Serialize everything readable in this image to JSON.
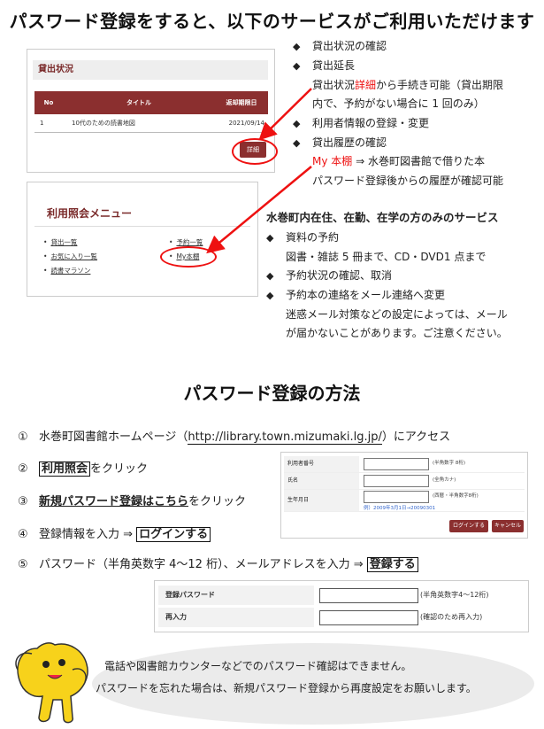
{
  "title1": "パスワード登録をすると、以下のサービスがご利用いただけます",
  "title2": "パスワード登録の方法",
  "lending_panel": {
    "heading": "貸出状況",
    "col_no": "No",
    "col_title": "タイトル",
    "col_due": "返却期限日",
    "row_no": "1",
    "row_title": "10代のための読書地図",
    "row_due": "2021/09/14",
    "detail_button": "詳細"
  },
  "menu_panel": {
    "title": "利用照会メニュー",
    "items": [
      "貸出一覧",
      "お気に入り一覧",
      "読書マラソン",
      "予約一覧",
      "My本棚"
    ]
  },
  "services": {
    "b1": "貸出状況の確認",
    "b2": "貸出延長",
    "b2_l1_pre": "貸出状況",
    "b2_l1_red": "詳細",
    "b2_l1_post": "から手続き可能（貸出期限",
    "b2_l2": "内で、予約がない場合に 1 回のみ）",
    "b3": "利用者情報の登録・変更",
    "b4": "貸出履歴の確認",
    "b4_l1_red": "My 本棚",
    "b4_l1_post": " ⇒ 水巻町図書館で借りた本",
    "b4_l2": "パスワード登録後からの履歴が確認可能",
    "marker": "◆"
  },
  "residents": {
    "heading": "水巻町内在住、在勤、在学の方のみのサービス",
    "c1": "資料の予約",
    "c1_l1": "図書・雑誌 5 冊まで、CD・DVD1 点まで",
    "c2": "予約状況の確認、取消",
    "c3": "予約本の連絡をメール連絡へ変更",
    "c3_l1": "迷惑メール対策などの設定によっては、メール",
    "c3_l2": "が届かないことがあります。ご注意ください。"
  },
  "steps": {
    "s1_num": "①",
    "s1_pre": "水巻町図書館ホームページ（",
    "s1_url": "http://library.town.mizumaki.lg.jp/",
    "s1_post": "）にアクセス",
    "s2_num": "②",
    "s2_link": "利用照会",
    "s2_post": "をクリック",
    "s3_num": "③",
    "s3_link": "新規パスワード登録はこちら",
    "s3_post": "をクリック",
    "s4_num": "④",
    "s4_pre": "登録情報を入力 ⇒ ",
    "s4_btn": "ログインする",
    "s5_num": "⑤",
    "s5_pre": "パスワード（半角英数字 4～12 桁）、メールアドレスを入力 ⇒ ",
    "s5_btn": "登録する"
  },
  "login_form": {
    "card_label": "利用者番号",
    "card_hint": "(半角数字 8桁)",
    "name_label": "氏名",
    "name_hint": "(全角カナ)",
    "birth_label": "生年月日",
    "birth_hint": "(西暦・半角数字8桁)",
    "birth_example": "例）2009年3月1日→20090301",
    "login_button": "ログインする",
    "cancel_button": "キャンセル"
  },
  "password_form": {
    "pw_label": "登録パスワード",
    "pw_hint": "(半角英数字4～12桁)",
    "confirm_label": "再入力",
    "confirm_hint": "(確認のため再入力)"
  },
  "note": {
    "l1": "電話や図書館カウンターなどでのパスワード確認はできません。",
    "l2": "パスワードを忘れた場合は、新規パスワード登録から再度設定をお願いします。"
  }
}
